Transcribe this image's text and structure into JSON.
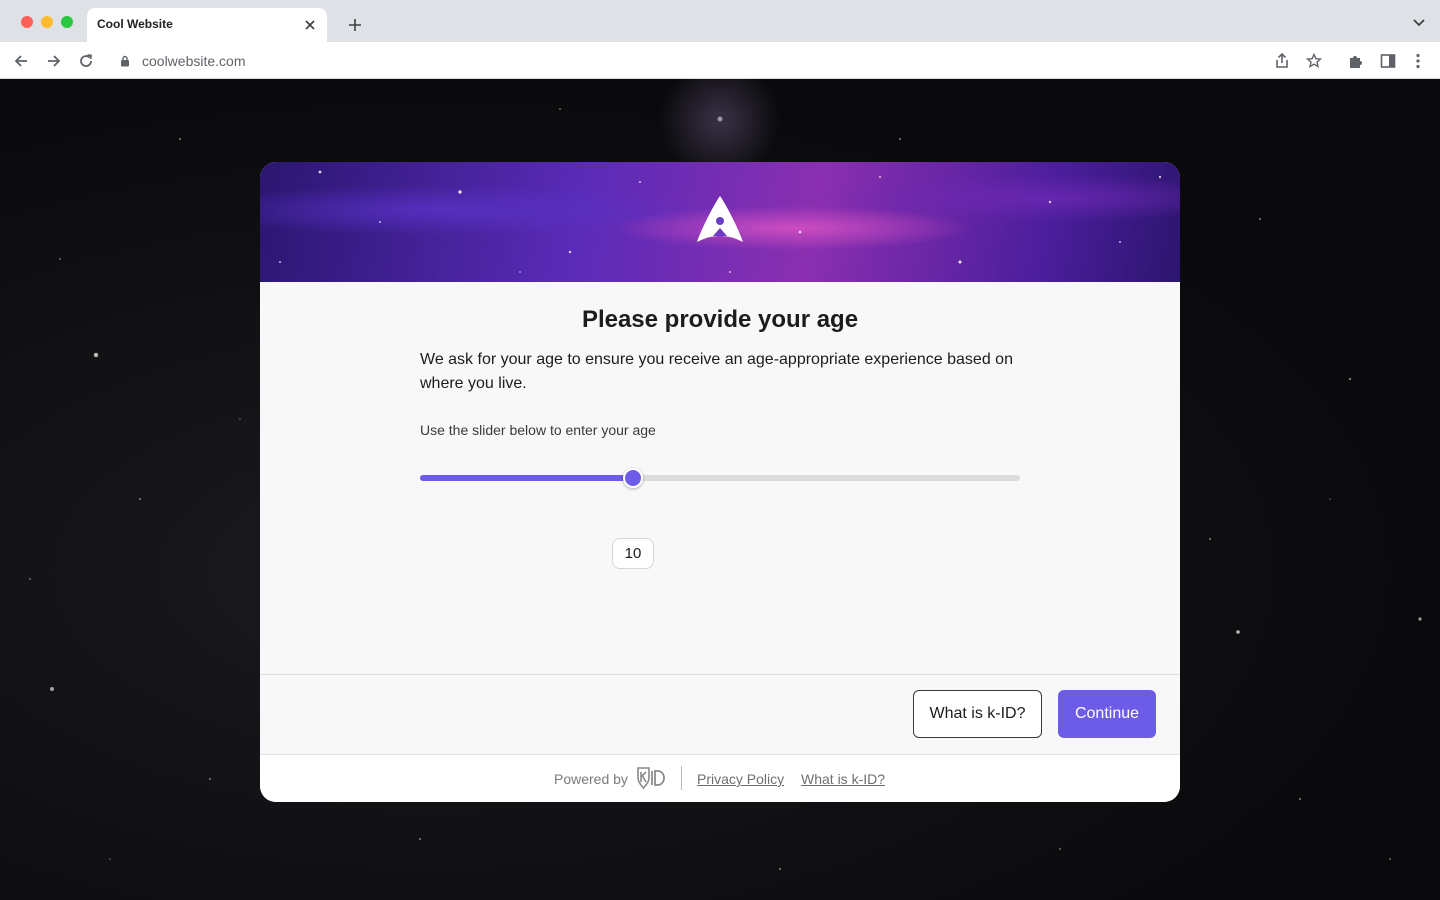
{
  "browser": {
    "tab_title": "Cool Website",
    "url": "coolwebsite.com"
  },
  "dialog": {
    "title": "Please provide your age",
    "description": "We ask for your age to ensure you receive an age-appropriate experience based on where you live.",
    "slider_label": "Use the slider below to enter your age",
    "slider": {
      "value": 10,
      "min": 0,
      "max": 28,
      "fill_fraction": 0.355
    },
    "value_display": "10",
    "buttons": {
      "what_is_kid": "What is k-ID?",
      "continue": "Continue"
    },
    "footer": {
      "powered_by": "Powered by",
      "privacy_policy": "Privacy Policy",
      "what_is_kid": "What is k-ID?"
    }
  },
  "colors": {
    "accent": "#6c5ce7",
    "track": "#dcdcdc",
    "text": "#1c1c1e"
  },
  "icons": [
    "back-arrow-icon",
    "forward-arrow-icon",
    "reload-icon",
    "lock-icon",
    "share-icon",
    "bookmark-star-icon",
    "extensions-icon",
    "sidebar-icon",
    "more-menu-icon",
    "close-icon",
    "plus-icon",
    "chevron-down-icon",
    "rocket-logo-icon",
    "kid-shield-logo-icon"
  ]
}
